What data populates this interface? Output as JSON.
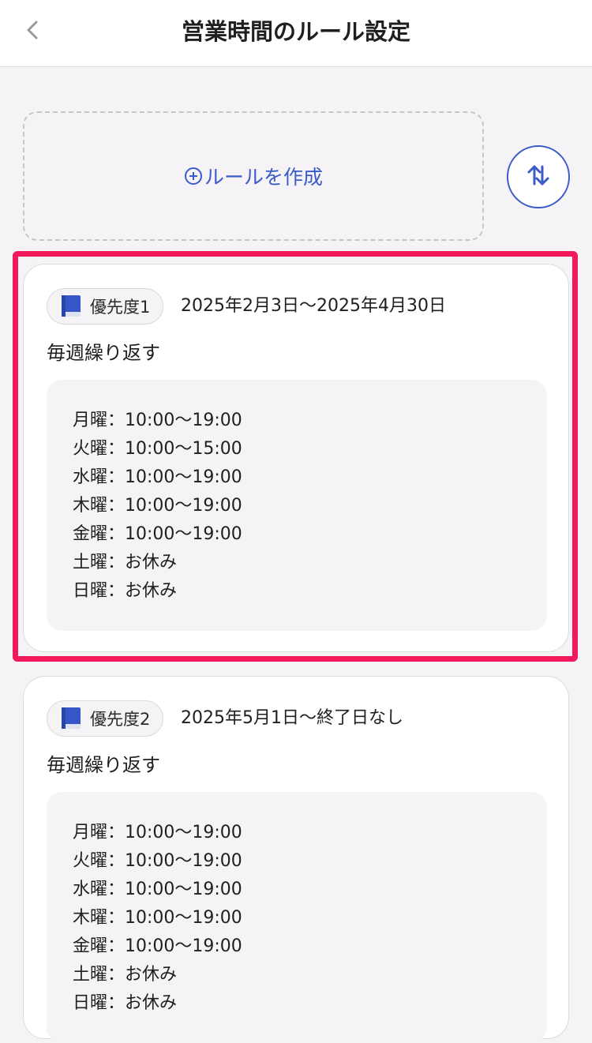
{
  "header": {
    "title": "営業時間のルール設定",
    "back_icon": "chevron-left-icon"
  },
  "create": {
    "label": "ルールを作成",
    "icon": "plus-circle-icon"
  },
  "sort": {
    "icon": "sort-arrows-icon"
  },
  "colors": {
    "accent": "#3b5cc8",
    "highlight": "#f2185c",
    "background": "#f5f3f5"
  },
  "rules": [
    {
      "priority": "優先度1",
      "date_range": "2025年2月3日〜2025年4月30日",
      "repeat": "毎週繰り返す",
      "schedule": [
        "月曜：10:00〜19:00",
        "火曜：10:00〜15:00",
        "水曜：10:00〜19:00",
        "木曜：10:00〜19:00",
        "金曜：10:00〜19:00",
        "土曜：お休み",
        "日曜：お休み"
      ]
    },
    {
      "priority": "優先度2",
      "date_range": "2025年5月1日〜終了日なし",
      "repeat": "毎週繰り返す",
      "schedule": [
        "月曜：10:00〜19:00",
        "火曜：10:00〜19:00",
        "水曜：10:00〜19:00",
        "木曜：10:00〜19:00",
        "金曜：10:00〜19:00",
        "土曜：お休み",
        "日曜：お休み"
      ]
    }
  ]
}
